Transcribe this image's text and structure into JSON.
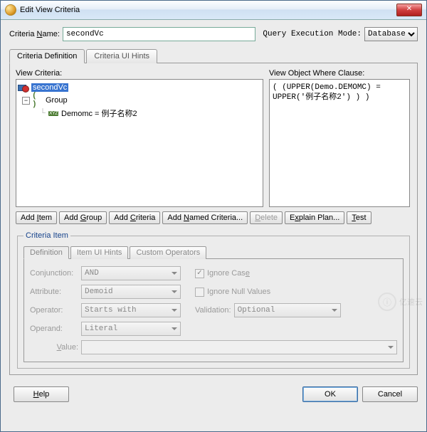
{
  "window": {
    "title": "Edit View Criteria"
  },
  "criteriaName": {
    "label": "Criteria ",
    "accessKey": "N",
    "labelSuffix": "ame:",
    "value": "secondVc"
  },
  "queryMode": {
    "label": "Query Execution Mode:",
    "value": "Database"
  },
  "tabs": {
    "definition": "Criteria Definition",
    "uiHints": "Criteria UI Hints"
  },
  "viewCriteria": {
    "label": "View Criteria:",
    "root": "secondVc",
    "group": "Group",
    "item": "Demomc = 例子名称2"
  },
  "whereClause": {
    "label": "View Object Where Clause:",
    "text": "( (UPPER(Demo.DEMOMC) = UPPER('例子名称2') ) )"
  },
  "buttons": {
    "addItem": {
      "pre": "Add ",
      "u": "I",
      "post": "tem"
    },
    "addGroup": {
      "pre": "Add ",
      "u": "G",
      "post": "roup"
    },
    "addCriteria": {
      "pre": "Add ",
      "u": "C",
      "post": "riteria"
    },
    "addNamed": {
      "pre": "Add ",
      "u": "N",
      "post": "amed Criteria..."
    },
    "delete": {
      "u": "D",
      "post": "elete"
    },
    "explain": {
      "pre": "E",
      "u": "x",
      "post": "plain Plan..."
    },
    "test": {
      "u": "T",
      "post": "est"
    }
  },
  "criteriaItem": {
    "legend": "Criteria Item",
    "subtabs": {
      "def": "Definition",
      "ui": "Item UI Hints",
      "custom": "Custom Operators"
    },
    "conjunction": {
      "label": "Conjunction:",
      "value": "AND"
    },
    "attribute": {
      "label": "Attribute:",
      "value": "Demoid"
    },
    "operator": {
      "label": "Operator:",
      "value": "Starts with"
    },
    "operand": {
      "label": "Operand:",
      "value": "Literal"
    },
    "valueLabel": "Value:",
    "ignoreCase": {
      "label": "Ignore Cas",
      "u": "e",
      "checked": "✓"
    },
    "ignoreNull": {
      "label": "Ignore Null Values"
    },
    "validation": {
      "label": "Validation:",
      "value": "Optional"
    }
  },
  "footer": {
    "help": {
      "u": "H",
      "post": "elp"
    },
    "ok": "OK",
    "cancel": "Cancel"
  },
  "watermark": "亿速云"
}
